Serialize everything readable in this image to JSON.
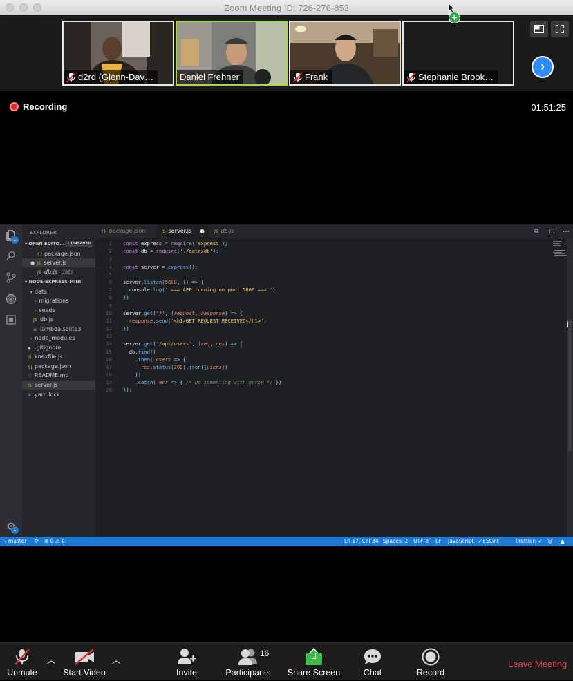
{
  "window": {
    "title": "Zoom Meeting ID: 726-276-853"
  },
  "participants": [
    {
      "name": "d2rd (Glenn-Dav…",
      "muted": true,
      "active": false
    },
    {
      "name": "Daniel Frehner",
      "muted": false,
      "active": true
    },
    {
      "name": "Frank",
      "muted": true,
      "active": false
    },
    {
      "name": "Stephanie Brook…",
      "muted": true,
      "active": false
    }
  ],
  "recording": {
    "label": "Recording",
    "elapsed": "01:51:25"
  },
  "vscode": {
    "explorer_title": "EXPLORER",
    "open_editors_label": "OPEN EDITO...",
    "unsaved_badge": "1 UNSAVED",
    "open_editors": [
      {
        "name": "package.json",
        "type": "json",
        "selected": false,
        "dirty": false,
        "note": ""
      },
      {
        "name": "server.js",
        "type": "js",
        "selected": true,
        "dirty": true,
        "note": ""
      },
      {
        "name": "db.js",
        "type": "js",
        "selected": false,
        "dirty": false,
        "note": "data"
      }
    ],
    "project_label": "NODE-EXPRESS-MINI",
    "tree": [
      {
        "name": "data",
        "kind": "folder-open",
        "indent": 1
      },
      {
        "name": "migrations",
        "kind": "folder",
        "indent": 2
      },
      {
        "name": "seeds",
        "kind": "folder",
        "indent": 2
      },
      {
        "name": "db.js",
        "kind": "js",
        "indent": 2
      },
      {
        "name": "lambda.sqlite3",
        "kind": "db",
        "indent": 2
      },
      {
        "name": "node_modules",
        "kind": "folder",
        "indent": 1
      },
      {
        "name": ".gitignore",
        "kind": "git",
        "indent": 1
      },
      {
        "name": "knexfile.js",
        "kind": "js",
        "indent": 1
      },
      {
        "name": "package.json",
        "kind": "json",
        "indent": 1
      },
      {
        "name": "README.md",
        "kind": "md",
        "indent": 1
      },
      {
        "name": "server.js",
        "kind": "js",
        "indent": 1,
        "selected": true
      },
      {
        "name": "yarn.lock",
        "kind": "lock",
        "indent": 1
      }
    ],
    "tabs": [
      {
        "label": "package.json",
        "icon": "{}",
        "active": false,
        "italic": false
      },
      {
        "label": "server.js",
        "icon": "JS",
        "active": true,
        "italic": false
      },
      {
        "label": "db.js",
        "icon": "JS",
        "active": false,
        "italic": true
      }
    ],
    "code_lines": [
      "const express = require('express');",
      "const db = require('./data/db');",
      "",
      "const server = express();",
      "",
      "server.listen(5000, () => {",
      "  console.log(' === APP running on port 5000 === ')",
      "})",
      "",
      "server.get('/', (request, response) => {",
      "  response.send('<h1>GET REQUEST RECEIVED</h1>')",
      "})",
      "",
      "server.get('/api/users', (req, res) => {",
      "  db.find()",
      "    .then( users => {",
      "      res.status(200).json({users})",
      "    })",
      "    .catch( err => { /* Do somehting with error */ })",
      "});"
    ],
    "status": {
      "branch": "master",
      "problems": "0",
      "warnings": "0",
      "cursor": "Ln 17, Col 34",
      "spaces": "Spaces: 2",
      "encoding": "UTF-8",
      "eol": "LF",
      "language": "JavaScript",
      "eslint": "ESLint",
      "prettier": "Prettier: ✓"
    },
    "badges": {
      "explorer": "1",
      "settings": "1"
    }
  },
  "toolbar": {
    "unmute": "Unmute",
    "start_video": "Start Video",
    "invite": "Invite",
    "participants": "Participants",
    "participant_count": "16",
    "share_screen": "Share Screen",
    "chat": "Chat",
    "record": "Record",
    "leave": "Leave Meeting"
  },
  "colors": {
    "zoom_blue": "#2d8cff",
    "active_speaker": "#a8d84a",
    "share_green": "#2fa54a",
    "leave_red": "#e8464a",
    "vscode_status": "#1f7ad4"
  }
}
